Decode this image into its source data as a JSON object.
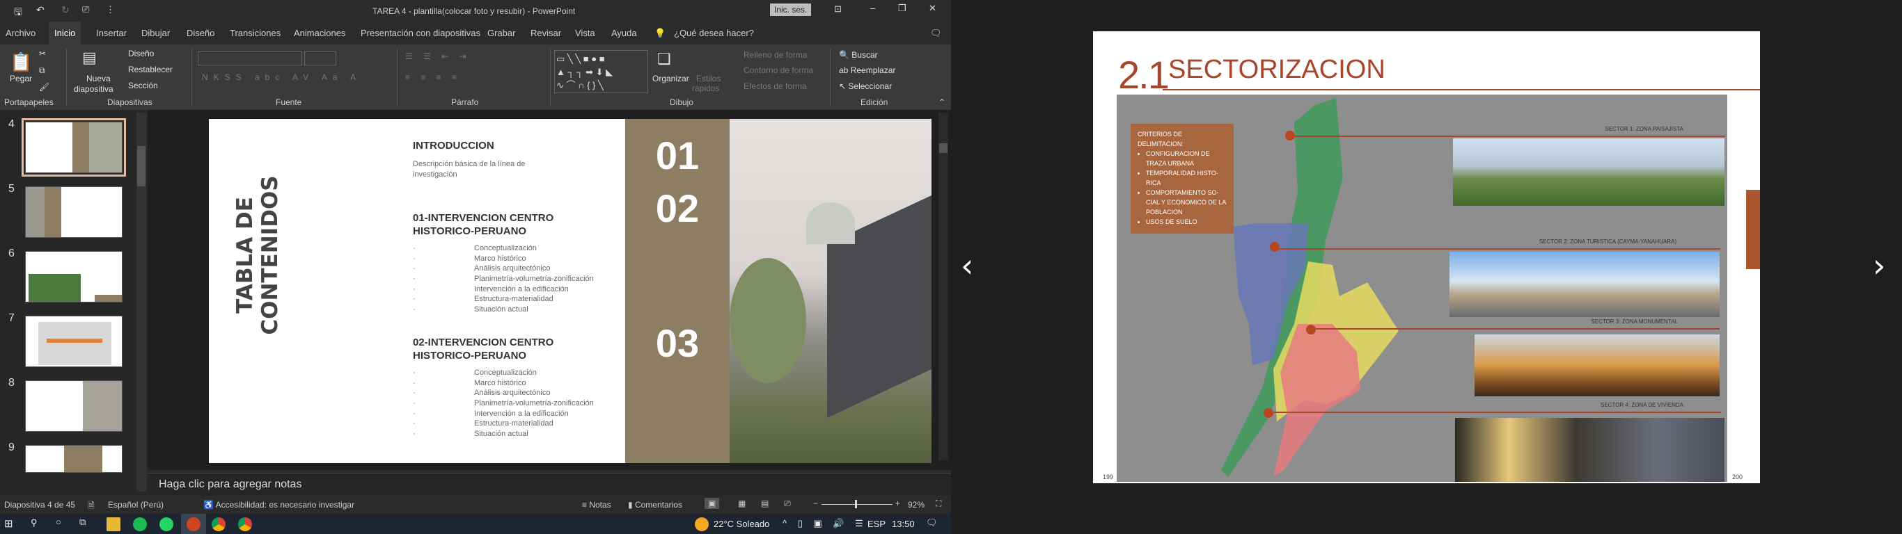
{
  "window": {
    "title": "TAREA 4 - plantilla(colocar foto y resubir)  -  PowerPoint",
    "signin": "Inic. ses."
  },
  "tabs": [
    "Archivo",
    "Inicio",
    "Insertar",
    "Dibujar",
    "Diseño",
    "Transiciones",
    "Animaciones",
    "Presentación con diapositivas",
    "Grabar",
    "Revisar",
    "Vista",
    "Ayuda",
    "¿Qué desea hacer?"
  ],
  "ribbon": {
    "pegar": "Pegar",
    "nueva": "Nueva",
    "diapositiva": "diapositiva",
    "diseno": "Diseño",
    "restablecer": "Restablecer",
    "seccion": "Sección",
    "organizar": "Organizar",
    "estilos": "Estilos",
    "rapidos": "rápidos",
    "relleno": "Relleno de forma",
    "contorno": "Contorno de forma",
    "efectos": "Efectos de forma",
    "buscar": "Buscar",
    "reemplazar": "Reemplazar",
    "seleccionar": "Seleccionar",
    "groups": [
      "Portapapeles",
      "Diapositivas",
      "Fuente",
      "Párrafo",
      "Dibujo",
      "Edición"
    ]
  },
  "thumbnails": [
    {
      "num": "4",
      "selected": true
    },
    {
      "num": "5"
    },
    {
      "num": "6"
    },
    {
      "num": "7"
    },
    {
      "num": "8"
    },
    {
      "num": "9"
    }
  ],
  "slide": {
    "vertical_title_1": "TABLA DE",
    "vertical_title_2": "CONTENIDOS",
    "intro_title": "INTRODUCCION",
    "intro_desc_1": "Descripción básica de la línea de",
    "intro_desc_2": "investigación",
    "section1_title_1": "01-INTERVENCION CENTRO",
    "section1_title_2": "HISTORICO-PERUANO",
    "section2_title_1": "02-INTERVENCION CENTRO",
    "section2_title_2": "HISTORICO-PERUANO",
    "items": [
      "Conceptualización",
      "Marco histórico",
      "Análisis arquitectónico",
      "Planimetría-volumetría-zonificación",
      "Intervención a la edificación",
      "Estructura-materialidad",
      "Situación actual"
    ],
    "bullet": "·",
    "numbers": [
      "01",
      "02",
      "03"
    ],
    "band_color": "#8c7d63"
  },
  "notes_placeholder": "Haga clic para agregar notas",
  "status": {
    "slide_count": "Diapositiva 4 de 45",
    "language": "Español (Perú)",
    "accessibility": "Accesibilidad: es necesario investigar",
    "notes": "Notas",
    "comments": "Comentarios",
    "zoom": "92%",
    "zoom_level": 92
  },
  "taskbar": {
    "weather": "22°C  Soleado",
    "lang": "ESP",
    "time": "13:50"
  },
  "viewer": {
    "number": "2.1",
    "title": "SECTORIZACION",
    "criteria_title_1": "CRITERIOS DE",
    "criteria_title_2": "DELIMITACION:",
    "criteria": [
      "CONFIGURACION DE TRAZA URBANA",
      "TEMPORALIDAD HISTO-RICA",
      "COMPORTAMIENTO SO-CIAL Y ECONOMICO DE LA POBLACION",
      "USOS DE SUELO"
    ],
    "sectors": [
      "SECTOR 1: ZONA PAISAJISTA",
      "SECTOR 2: ZONA TURISTICA (CAYMA-YANAHUARA)",
      "SECTOR 3: ZONA MONUMENTAL",
      "SECTOR 4: ZONA DE VIVIENDA"
    ],
    "page_left": "199",
    "page_right": "200",
    "accent": "#a8452a",
    "prev": "‹",
    "next": "›"
  }
}
